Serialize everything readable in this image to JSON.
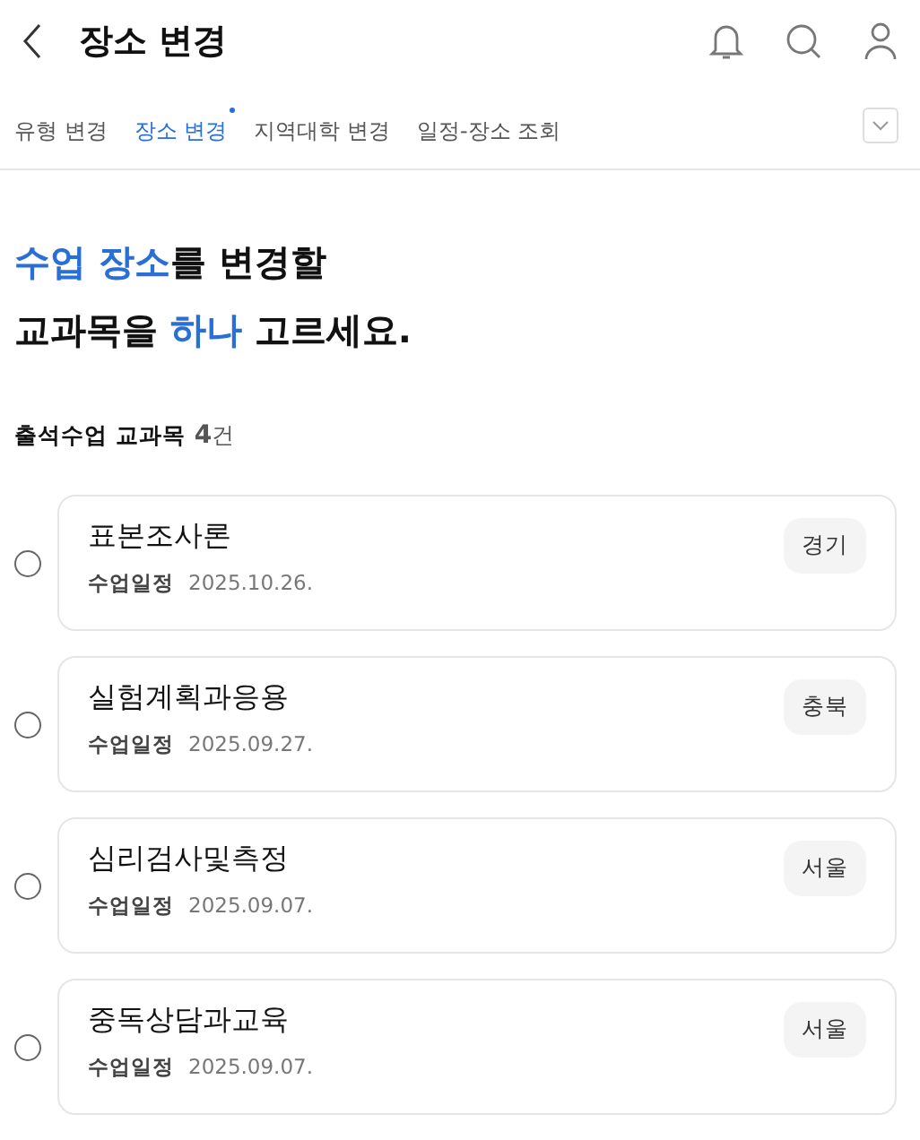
{
  "header": {
    "title": "장소 변경"
  },
  "tabs": [
    {
      "label": "유형 변경",
      "selected": false
    },
    {
      "label": "장소 변경",
      "selected": true
    },
    {
      "label": "지역대학 변경",
      "selected": false
    },
    {
      "label": "일정-장소 조회",
      "selected": false
    }
  ],
  "heading": [
    [
      {
        "text": "수업 장소",
        "accent": true
      },
      {
        "text": "를 변경할",
        "accent": false
      }
    ],
    [
      {
        "text": "교과목을 ",
        "accent": false
      },
      {
        "text": "하나",
        "accent": true
      },
      {
        "text": " 고르세요.",
        "accent": false
      }
    ]
  ],
  "count": {
    "label": "출석수업 교과목",
    "number": "4",
    "unit": "건"
  },
  "courses": [
    {
      "name": "표본조사론",
      "date_label": "수업일정",
      "date": "2025.10.26.",
      "region": "경기",
      "selected": false
    },
    {
      "name": "실험계획과응용",
      "date_label": "수업일정",
      "date": "2025.09.27.",
      "region": "충북",
      "selected": false
    },
    {
      "name": "심리검사및측정",
      "date_label": "수업일정",
      "date": "2025.09.07.",
      "region": "서울",
      "selected": false
    },
    {
      "name": "중독상담과교육",
      "date_label": "수업일정",
      "date": "2025.09.07.",
      "region": "서울",
      "selected": false
    }
  ]
}
